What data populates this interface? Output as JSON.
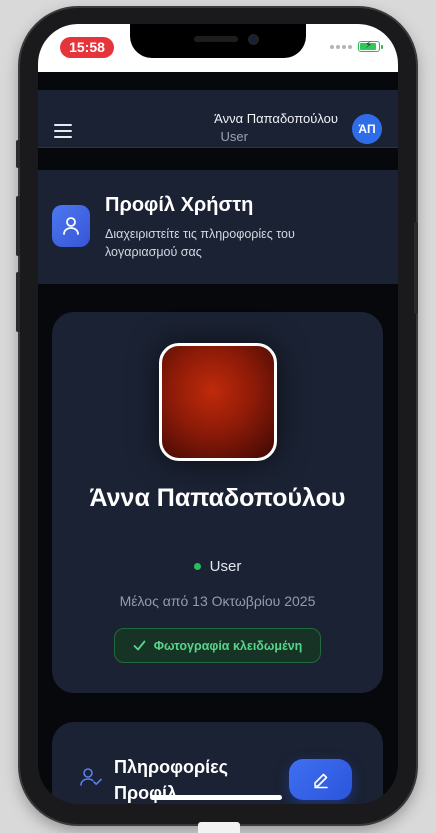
{
  "status_bar": {
    "time": "15:58",
    "time_pill_color": "#e5353b",
    "battery_color": "#33c659",
    "battery_icon": "battery-charging-icon"
  },
  "header": {
    "menu_icon": "hamburger-icon",
    "user_name": "Άννα Παπαδοπούλου",
    "user_role": "User",
    "avatar_initials": "ΆΠ",
    "avatar_color": "#2f6de8"
  },
  "page": {
    "icon": "user-icon",
    "title": "Προφίλ Χρήστη",
    "subtitle": "Διαχειριστείτε τις πληροφορίες του λογαριασμού σας"
  },
  "profile": {
    "photo": "profile-photo",
    "full_name": "Άννα Παπαδοπούλου",
    "role": "User",
    "online_status_color": "#23c05b",
    "member_since": "Μέλος από 13 Οκτωβρίου 2025",
    "lock_badge": "Φωτογραφία κλειδωμένη",
    "lock_badge_icon": "check-icon"
  },
  "info_section": {
    "icon": "user-check-icon",
    "title": "Πληροφορίες Προφίλ"
  },
  "fab": {
    "icon": "edit-pen-icon",
    "color": "#3f6ff0"
  }
}
